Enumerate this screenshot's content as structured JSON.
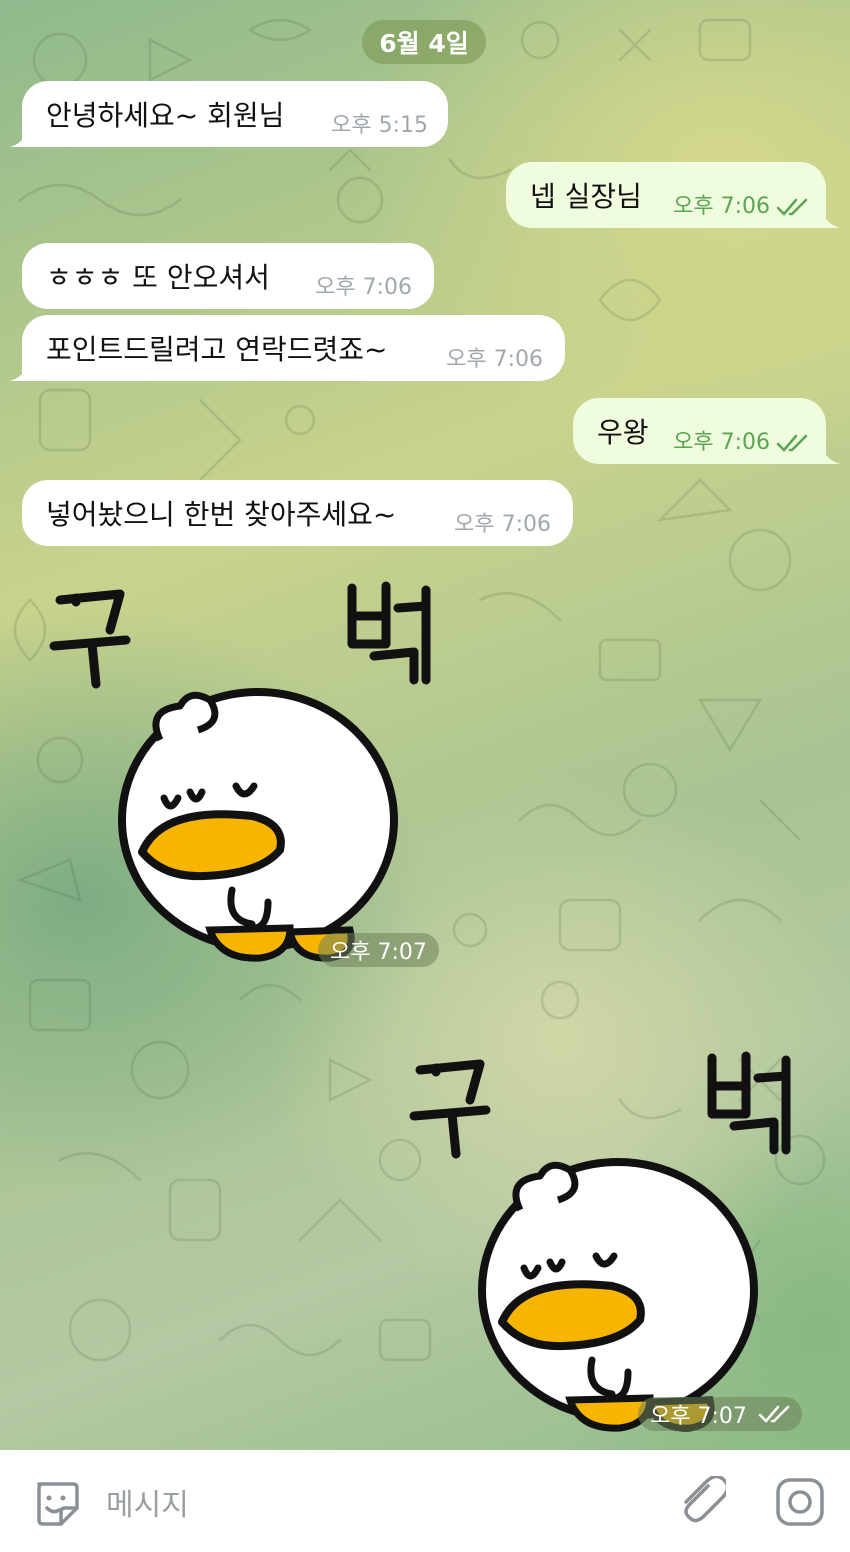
{
  "date_label": "6월 4일",
  "messages": [
    {
      "text": "안녕하세요~ 회원님",
      "time": "오후 5:15"
    },
    {
      "text": "넵 실장님",
      "time": "오후 7:06"
    },
    {
      "text": "ㅎㅎㅎ 또 안오셔서",
      "time": "오후 7:06"
    },
    {
      "text": "포인트드릴려고 연락드렷죠~",
      "time": "오후 7:06"
    },
    {
      "text": "우왕",
      "time": "오후 7:06"
    },
    {
      "text": "넣어놨으니 한번 찾아주세요~",
      "time": "오후 7:06"
    }
  ],
  "stickers": [
    {
      "caption": "꾸 벅",
      "time": "오후 7:07"
    },
    {
      "caption": "꾸 벅",
      "time": "오후 7:07"
    }
  ],
  "input": {
    "placeholder": "메시지"
  },
  "icons": [
    "sticker-icon",
    "attach-icon",
    "camera-icon",
    "double-check-icon"
  ]
}
